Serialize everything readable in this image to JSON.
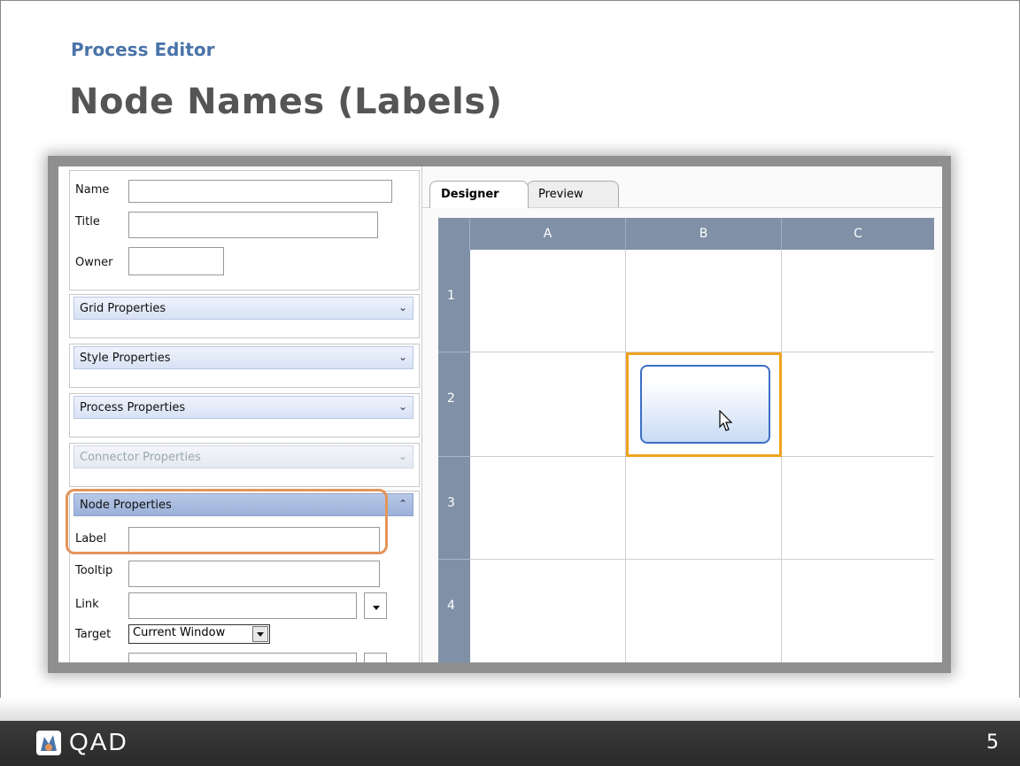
{
  "slide": {
    "subtitle": "Process Editor",
    "title": "Node Names (Labels)",
    "page_number": "5",
    "logo_text": "QAD"
  },
  "left_panel": {
    "fields": {
      "name_label": "Name",
      "title_label": "Title",
      "owner_label": "Owner"
    },
    "sections": [
      {
        "label": "Grid Properties",
        "state": "collapsed"
      },
      {
        "label": "Style Properties",
        "state": "collapsed"
      },
      {
        "label": "Process Properties",
        "state": "collapsed"
      },
      {
        "label": "Connector Properties",
        "state": "disabled"
      },
      {
        "label": "Node Properties",
        "state": "expanded"
      }
    ],
    "node_properties": {
      "label_label": "Label",
      "tooltip_label": "Tooltip",
      "link_label": "Link",
      "target_label": "Target",
      "target_value": "Current Window"
    }
  },
  "designer": {
    "tabs": [
      {
        "label": "Designer",
        "active": true
      },
      {
        "label": "Preview",
        "active": false
      }
    ],
    "columns": [
      "A",
      "B",
      "C"
    ],
    "rows": [
      "1",
      "2",
      "3",
      "4"
    ],
    "selected_cell": "B2"
  },
  "colors": {
    "accent_blue": "#4a74a8",
    "grid_header": "#7f90a7",
    "selection_orange": "#f0a31e",
    "highlight_orange": "#e3955b"
  }
}
